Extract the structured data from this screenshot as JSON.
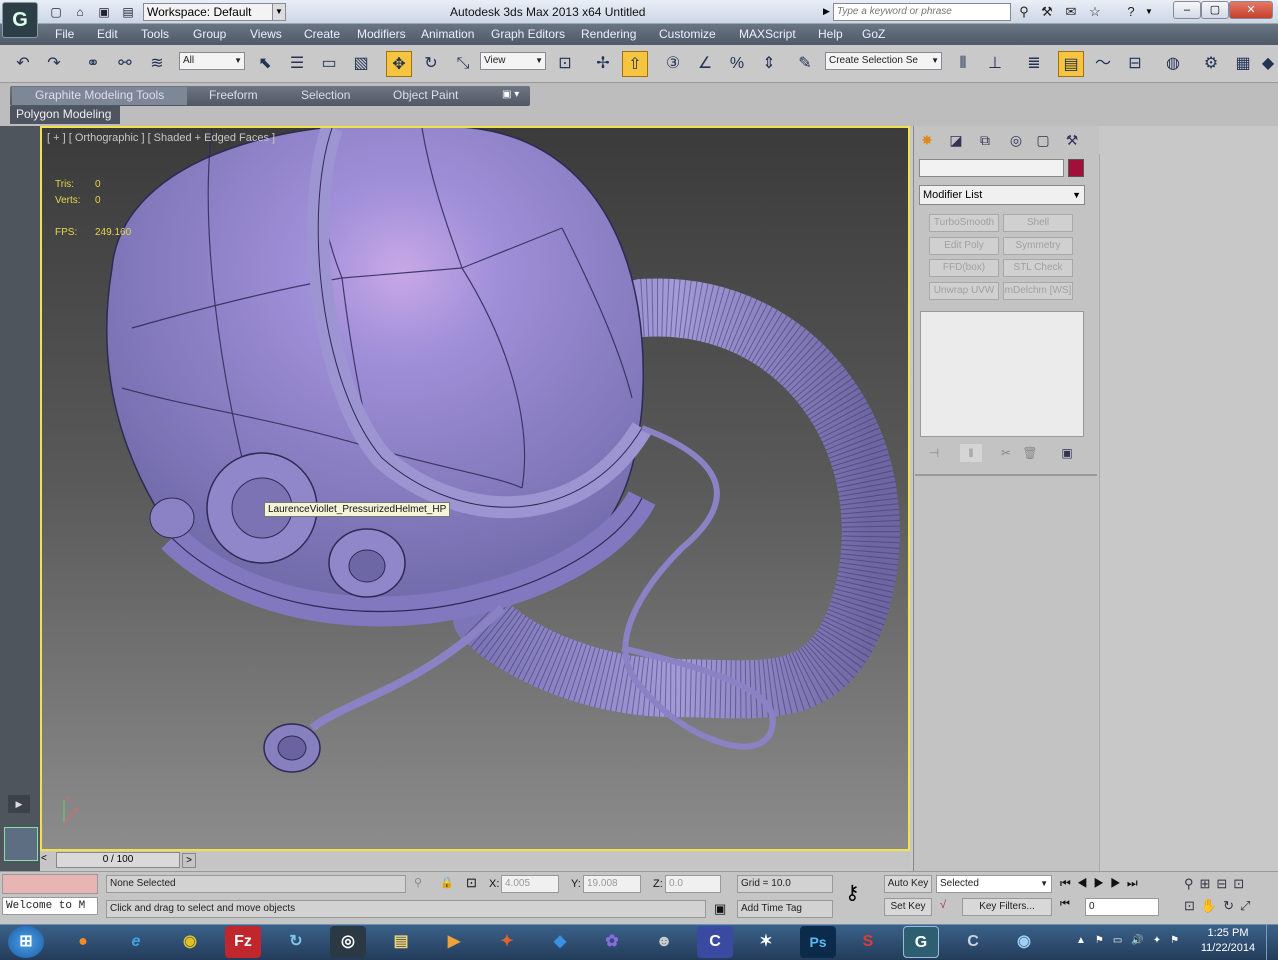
{
  "titlebar": {
    "title": "Autodesk 3ds Max  2013 x64     Untitled",
    "workspace": "Workspace: Default",
    "search_placeholder": "Type a keyword or phrase",
    "app_logo": "3ds-max-logo",
    "window_controls": [
      "minimize",
      "maximize",
      "close"
    ]
  },
  "menubar": {
    "items": [
      "File",
      "Edit",
      "Tools",
      "Group",
      "Views",
      "Create",
      "Modifiers",
      "Animation",
      "Graph Editors",
      "Rendering",
      "Customize",
      "MAXScript",
      "Help",
      "GoZ"
    ]
  },
  "toolbar": {
    "selection_filter": "All",
    "ref_coord": "View",
    "named_selection": "Create Selection Se",
    "active_tool": "select-and-move"
  },
  "ribbon": {
    "tabs": [
      "Graphite Modeling Tools",
      "Freeform",
      "Selection",
      "Object Paint"
    ],
    "active_tab": "Graphite Modeling Tools",
    "panel": "Polygon Modeling"
  },
  "viewport": {
    "label": "[ + ] [ Orthographic ] [ Shaded + Edged Faces ]",
    "stats": {
      "tris_label": "Tris:",
      "tris_value": "0",
      "verts_label": "Verts:",
      "verts_value": "0",
      "fps_label": "FPS:",
      "fps_value": "249.160"
    },
    "tooltip": "LaurenceViollet_PressurizedHelmet_HP",
    "border_color": "#f2e14a",
    "model_color": "#8d86c9"
  },
  "command_panel": {
    "swatch_color": "#a0103a",
    "modifier_list": "Modifier List",
    "modifier_buttons": [
      "TurboSmooth",
      "Shell",
      "Edit Poly",
      "Symmetry",
      "FFD(box)",
      "STL Check",
      "Unwrap UVW",
      "mDelchm [WS]"
    ]
  },
  "timeline": {
    "frame": "0 / 100"
  },
  "statusbar": {
    "selection": "None Selected",
    "prompt": "Click and drag to select and move objects",
    "maxscript": "Welcome to M",
    "x_label": "X:",
    "x_value": "4.005",
    "y_label": "Y:",
    "y_value": "19.008",
    "z_label": "Z:",
    "z_value": "0.0",
    "grid": "Grid = 10.0",
    "auto_key": "Auto Key",
    "set_key": "Set Key",
    "selected_option": "Selected",
    "key_filters": "Key Filters...",
    "add_time_tag": "Add Time Tag",
    "frame_field": "0"
  },
  "taskbar": {
    "time": "1:25 PM",
    "date": "11/22/2014",
    "apps": [
      "windows-start",
      "firefox",
      "internet-explorer",
      "chrome",
      "filezilla",
      "sync-app",
      "steam",
      "file-explorer",
      "media-player",
      "codeblocks",
      "dropbox",
      "app-purple",
      "monkey-app",
      "photoshop-c",
      "zbrush",
      "photoshop",
      "substance",
      "3ds-max",
      "app-c",
      "app-lens"
    ]
  }
}
